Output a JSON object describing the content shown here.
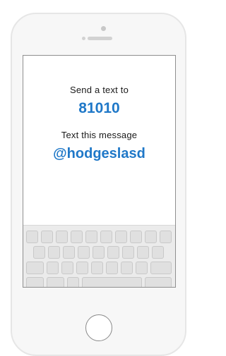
{
  "screen": {
    "send_label": "Send a text to",
    "phone_number": "81010",
    "message_label": "Text this message",
    "keyword": "@hodgeslasd"
  },
  "colors": {
    "accent": "#1f78c8",
    "device_frame": "#f7f7f7",
    "keyboard_bg": "#ebebeb",
    "key_fill": "#e0e0e0"
  },
  "keyboard": {
    "row_key_counts": [
      10,
      9,
      9,
      5
    ]
  }
}
